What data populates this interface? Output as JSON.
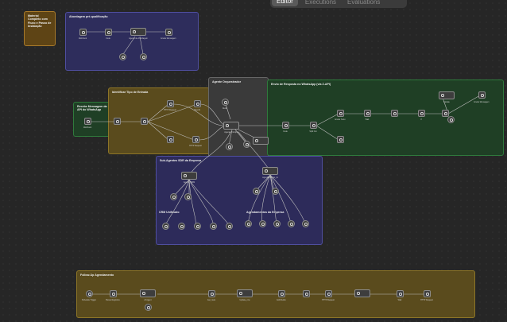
{
  "tabs": [
    "Editor",
    "Executions",
    "Evaluations"
  ],
  "stickies": {
    "material": {
      "title": "Material Completo com Fluxo e Passo de Instalação",
      "sub": ""
    },
    "abordagem": {
      "title": "Abordagem pré-qualificação",
      "sub": ""
    },
    "recebe": {
      "title": "Recebe Mensagem da API do WhatsApp",
      "sub": ""
    },
    "identificar": {
      "title": "Identificar Tipo de Entrada",
      "sub": ""
    },
    "agente": {
      "title": "Agente Orquestrador",
      "sub": ""
    },
    "envio": {
      "title": "Envio de Resposta no WhatsApp (via Z-API)",
      "sub": ""
    },
    "subagentes": {
      "title": "Sub-Agentes SDR da Empresa",
      "sub": ""
    },
    "crm": {
      "title": "CRM Unificado",
      "sub": ""
    },
    "agendamentos": {
      "title": "Agendamentos da Empresa",
      "sub": ""
    },
    "followup": {
      "title": "Follow-Up Agendamento",
      "sub": ""
    }
  },
  "nodes": {
    "webhook1": "Webhook",
    "code1": "Code",
    "agente_ia": "Agente de Abordagem",
    "enviar_msg": "Enviar Mensagem",
    "webhook2": "Webhook",
    "http1": "HTTP Request",
    "openai": "OpenAI",
    "http2": "HTTP Request",
    "agente_principal": "Agente Principal",
    "redis": "Redis",
    "code2": "Code",
    "split": "Split Out",
    "enviar_texto": "Enviar Texto",
    "wait": "Wait",
    "if1": "If",
    "update": "Update",
    "enviar_msg2": "Enviar Mensagem",
    "agente_crm": "Agente_CRM",
    "agente_agenda": "Agendamentos_IA",
    "schedule": "Schedule Trigger",
    "busca": "Busca Registros",
    "ai_agent": "AI Agent",
    "get_rows": "Get_rows",
    "update_row": "Update_row",
    "set_fields": "Edit Fields",
    "http3": "HTTP Request",
    "wait2": "Wait",
    "http4": "HTTP Request"
  }
}
